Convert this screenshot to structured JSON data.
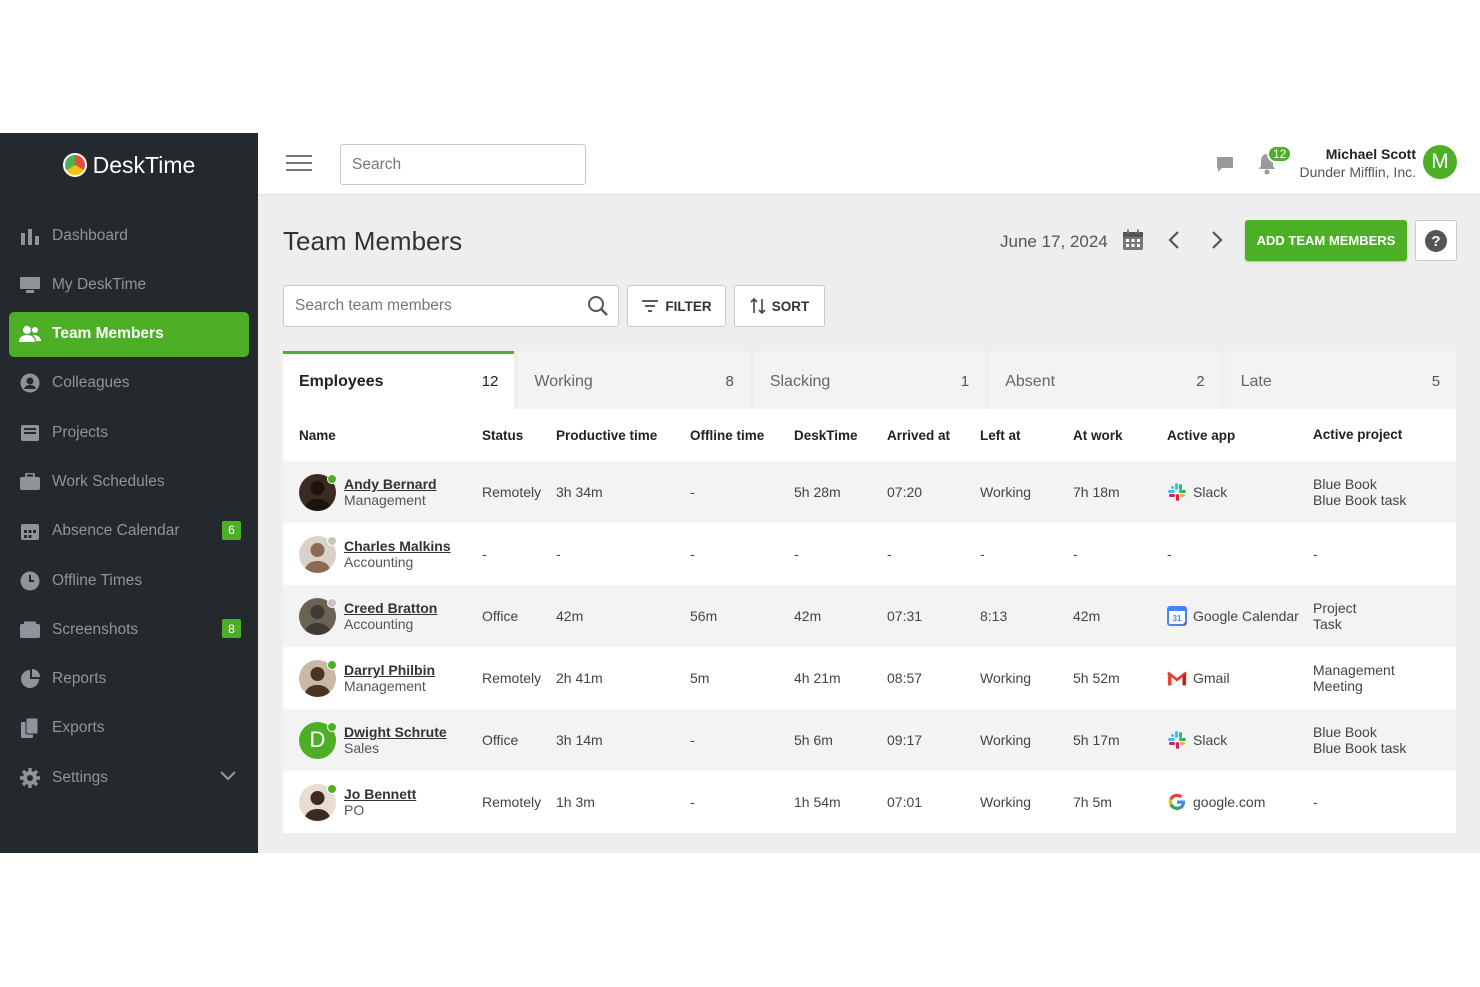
{
  "app": {
    "name": "DeskTime"
  },
  "sidebar": {
    "items": [
      {
        "label": "Dashboard",
        "icon": "bar-chart-icon",
        "active": false
      },
      {
        "label": "My DeskTime",
        "icon": "monitor-icon",
        "active": false
      },
      {
        "label": "Team Members",
        "icon": "users-icon",
        "active": true
      },
      {
        "label": "Colleagues",
        "icon": "user-circle-icon",
        "active": false
      },
      {
        "label": "Projects",
        "icon": "inbox-icon",
        "active": false
      },
      {
        "label": "Work Schedules",
        "icon": "briefcase-icon",
        "active": false
      },
      {
        "label": "Absence Calendar",
        "icon": "calendar-icon",
        "active": false,
        "badge": "6"
      },
      {
        "label": "Offline Times",
        "icon": "clock-icon",
        "active": false
      },
      {
        "label": "Screenshots",
        "icon": "screenshot-icon",
        "active": false,
        "badge": "8"
      },
      {
        "label": "Reports",
        "icon": "pie-chart-icon",
        "active": false
      },
      {
        "label": "Exports",
        "icon": "files-icon",
        "active": false
      },
      {
        "label": "Settings",
        "icon": "gear-icon",
        "active": false
      }
    ]
  },
  "topbar": {
    "search_placeholder": "Search",
    "notifications_count": "12",
    "user_name": "Michael Scott",
    "user_company": "Dunder Mifflin, Inc.",
    "user_initial": "M"
  },
  "header": {
    "title": "Team Members",
    "date": "June 17, 2024",
    "add_button": "ADD TEAM MEMBERS",
    "help": "?"
  },
  "toolbar": {
    "search_placeholder": "Search team members",
    "filter_label": "FILTER",
    "sort_label": "SORT"
  },
  "tabs": [
    {
      "label": "Employees",
      "count": "12",
      "active": true
    },
    {
      "label": "Working",
      "count": "8",
      "active": false
    },
    {
      "label": "Slacking",
      "count": "1",
      "active": false
    },
    {
      "label": "Absent",
      "count": "2",
      "active": false
    },
    {
      "label": "Late",
      "count": "5",
      "active": false
    }
  ],
  "table": {
    "columns": [
      "Name",
      "Status",
      "Productive time",
      "Offline time",
      "DeskTime",
      "Arrived at",
      "Left at",
      "At work",
      "Active app",
      "Active project"
    ],
    "rows": [
      {
        "name": "Andy Bernard",
        "dept": "Management",
        "online": true,
        "avatar": "photo",
        "status": "Remotely",
        "productive": "3h 34m",
        "offline": "-",
        "desktime": "5h 28m",
        "arrived": "07:20",
        "left": "Working",
        "atwork": "7h 18m",
        "app": "Slack",
        "app_icon": "slack-icon",
        "project": "Blue Book",
        "task": "Blue Book task"
      },
      {
        "name": "Charles Malkins",
        "dept": "Accounting",
        "online": false,
        "avatar": "photo",
        "status": "-",
        "productive": "-",
        "offline": "-",
        "desktime": "-",
        "arrived": "-",
        "left": "-",
        "atwork": "-",
        "app": "-",
        "app_icon": "",
        "project": "-",
        "task": ""
      },
      {
        "name": "Creed Bratton",
        "dept": "Accounting",
        "online": false,
        "avatar": "photo",
        "status": "Office",
        "productive": "42m",
        "offline": "56m",
        "desktime": "42m",
        "arrived": "07:31",
        "left": "8:13",
        "atwork": "42m",
        "app": "Google Calendar",
        "app_icon": "google-calendar-icon",
        "project": "Project",
        "task": "Task"
      },
      {
        "name": "Darryl Philbin",
        "dept": "Management",
        "online": true,
        "avatar": "photo",
        "status": "Remotely",
        "productive": "2h 41m",
        "offline": "5m",
        "desktime": "4h 21m",
        "arrived": "08:57",
        "left": "Working",
        "atwork": "5h 52m",
        "app": "Gmail",
        "app_icon": "gmail-icon",
        "project": "Management",
        "task": "Meeting"
      },
      {
        "name": "Dwight Schrute",
        "dept": "Sales",
        "online": true,
        "avatar": "letter",
        "initial": "D",
        "status": "Office",
        "productive": "3h 14m",
        "offline": "-",
        "desktime": "5h 6m",
        "arrived": "09:17",
        "left": "Working",
        "atwork": "5h 17m",
        "app": "Slack",
        "app_icon": "slack-icon",
        "project": "Blue Book",
        "task": "Blue Book task"
      },
      {
        "name": "Jo Bennett",
        "dept": "PO",
        "online": true,
        "avatar": "photo",
        "status": "Remotely",
        "productive": "1h 3m",
        "offline": "-",
        "desktime": "1h 54m",
        "arrived": "07:01",
        "left": "Working",
        "atwork": "7h 5m",
        "app": "google.com",
        "app_icon": "google-icon",
        "project": "-",
        "task": ""
      }
    ]
  },
  "colors": {
    "accent": "#4caf25",
    "sidebar_bg": "#24292e",
    "online": "#4caf25",
    "offline": "#c5c5c5"
  }
}
